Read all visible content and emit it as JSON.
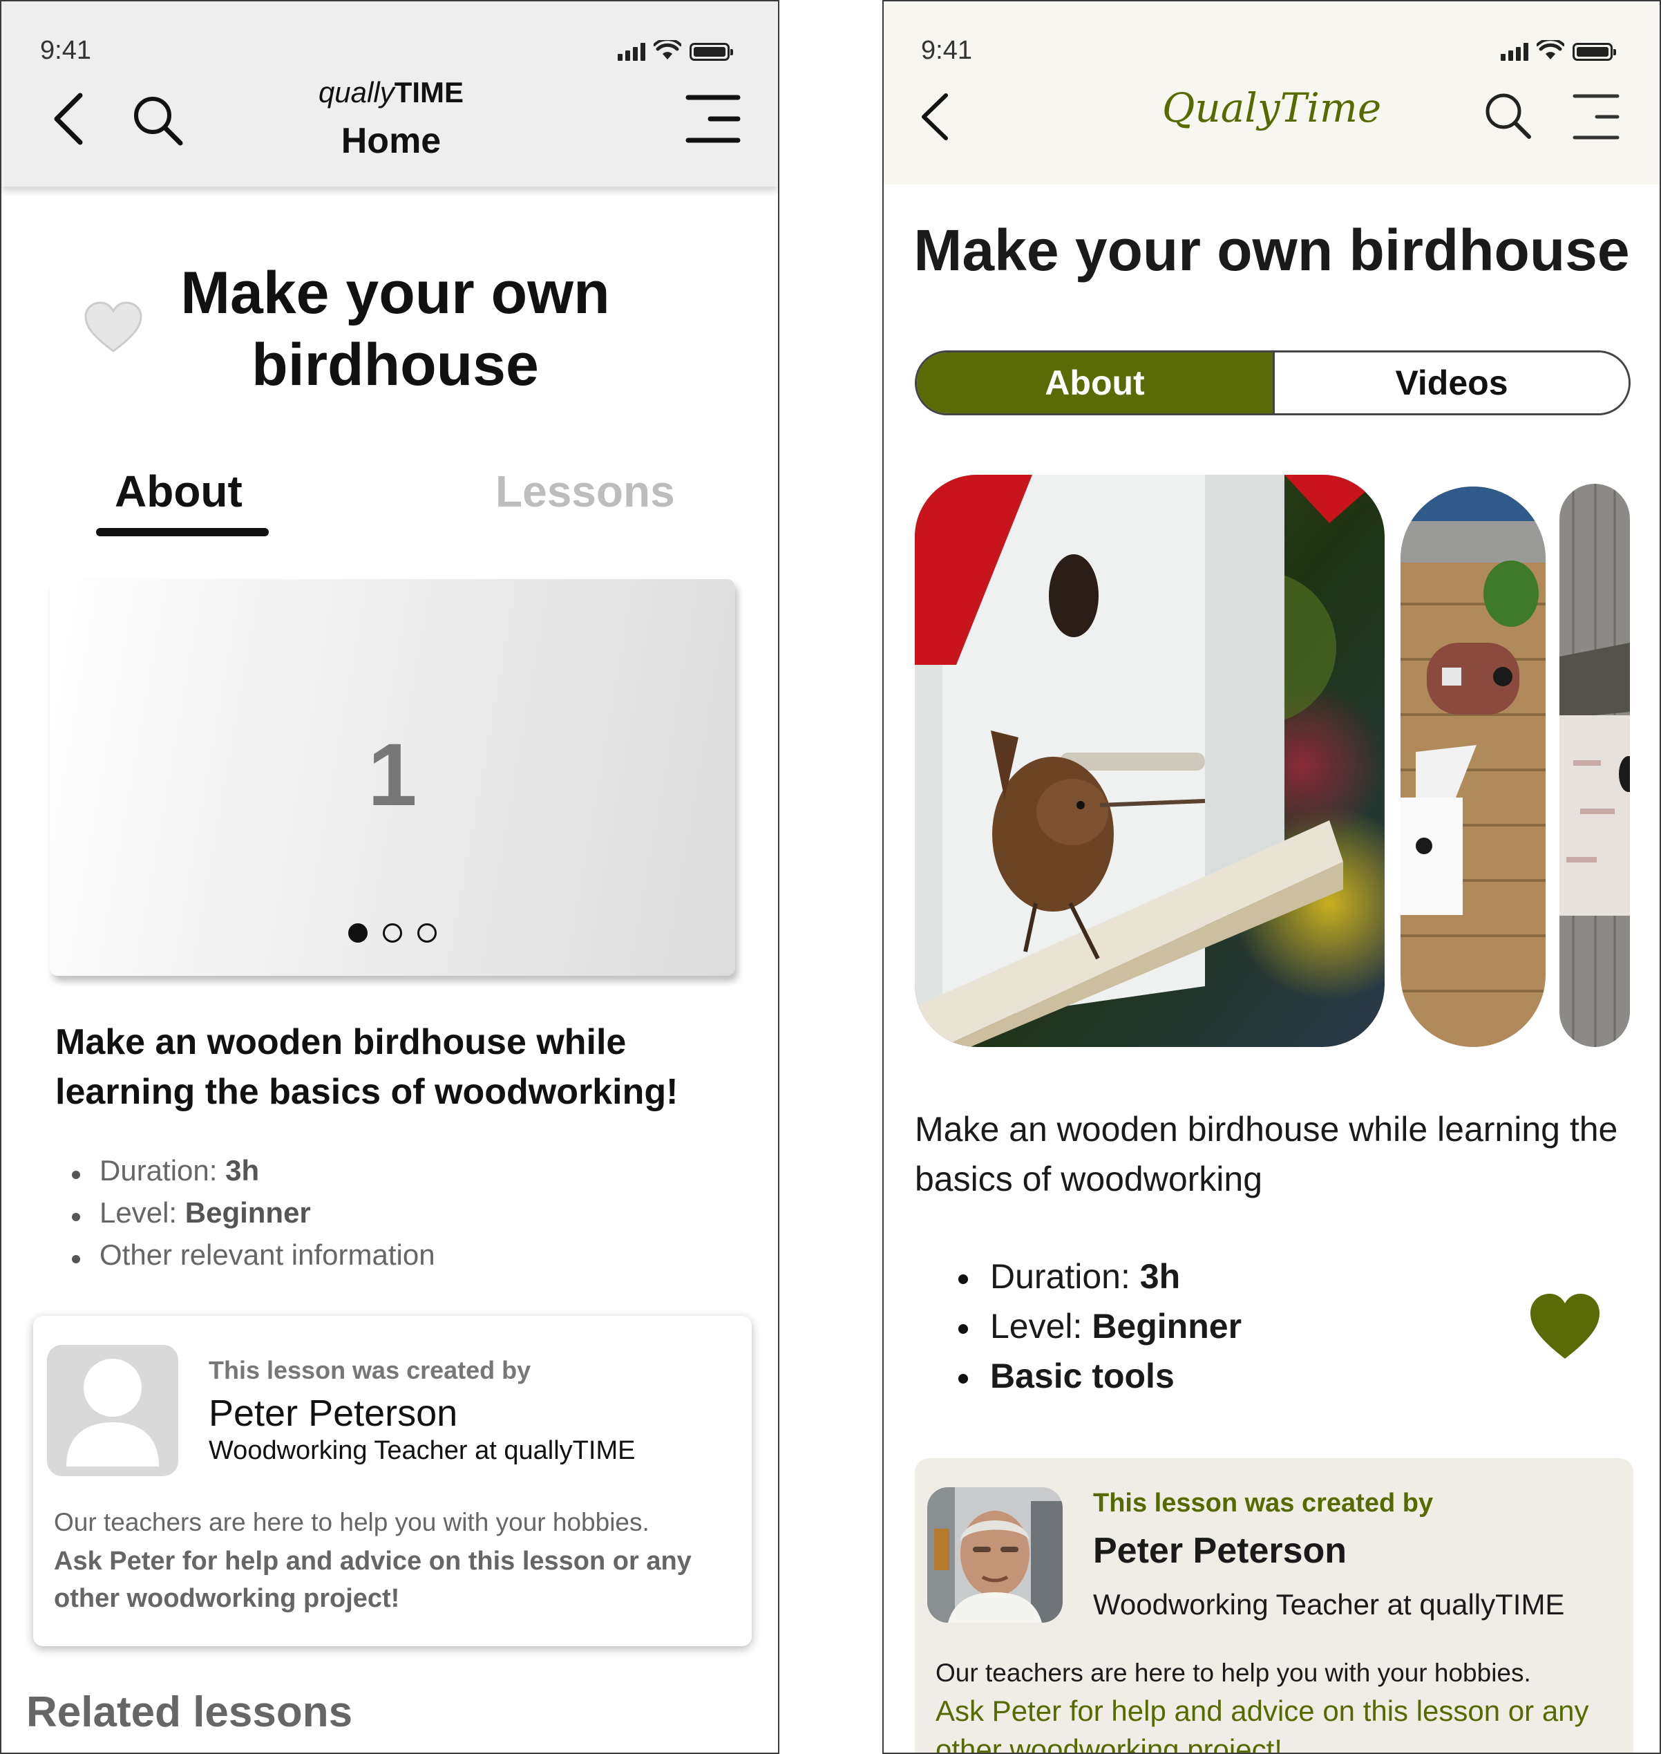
{
  "wireframe": {
    "status_time": "9:41",
    "brand_prefix": "qually",
    "brand_suffix": "TIME",
    "header_title": "Home",
    "title": "Make your own birdhouse",
    "tabs": [
      {
        "label": "About",
        "active": true
      },
      {
        "label": "Lessons",
        "active": false
      }
    ],
    "carousel": {
      "number": "1",
      "pages": 3,
      "current": 1
    },
    "description": "Make an wooden birdhouse while learning the basics of woodworking!",
    "details": [
      {
        "label": "Duration: ",
        "value": "3h"
      },
      {
        "label": "Level: ",
        "value": "Beginner"
      },
      {
        "label": "Other relevant information",
        "value": ""
      }
    ],
    "author": {
      "created_by": "This lesson was created by",
      "name": "Peter Peterson",
      "role": "Woodworking Teacher at quallyTIME",
      "help_line": "Our teachers are here to help you with your hobbies.",
      "help_cta": "Ask Peter for help and advice on this lesson or any other woodworking project!"
    },
    "related_heading": "Related lessons"
  },
  "hifi": {
    "status_time": "9:41",
    "brand": "QualyTime",
    "title": "Make your own birdhouse",
    "tabs": [
      {
        "label": "About",
        "active": true
      },
      {
        "label": "Videos",
        "active": false
      }
    ],
    "description": "Make an wooden birdhouse while learning the basics of woodworking",
    "details": [
      {
        "label": "Duration: ",
        "value": "3h"
      },
      {
        "label": "Level: ",
        "value": "Beginner"
      },
      {
        "label": "",
        "value": "Basic tools"
      }
    ],
    "author": {
      "created_by": "This lesson was created by",
      "name": "Peter Peterson",
      "role": "Woodworking Teacher at quallyTIME",
      "help_line": "Our teachers are here to help you with your hobbies.",
      "help_cta": "Ask Peter for help and advice on this lesson or any other woodworking project!"
    },
    "accent_color": "#5a6b06",
    "favorited": true
  },
  "icons": [
    "back-chevron-icon",
    "search-icon",
    "menu-icon",
    "heart-icon",
    "signal-icon",
    "wifi-icon",
    "battery-icon",
    "user-placeholder-icon"
  ]
}
